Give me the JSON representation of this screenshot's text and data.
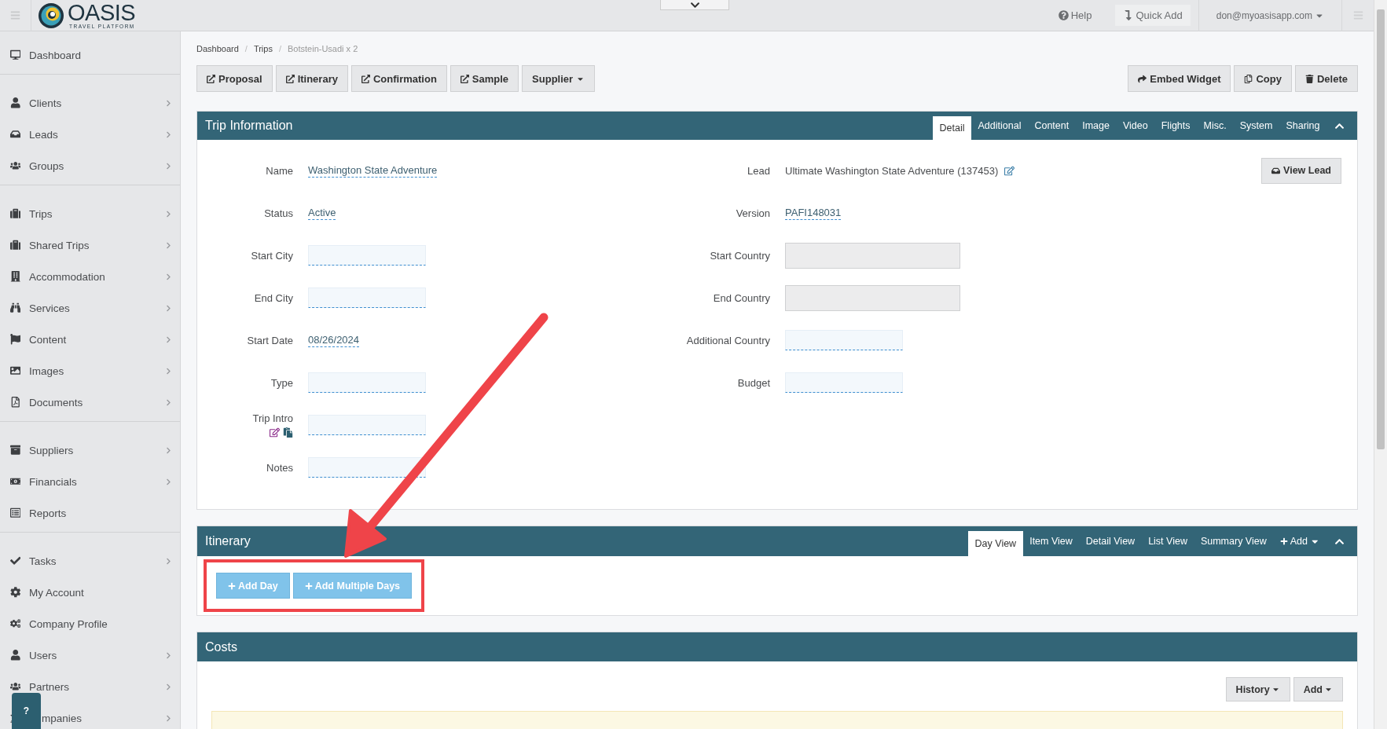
{
  "top_bar": {
    "logo": {
      "name": "OASIS",
      "tagline": "TRAVEL PLATFORM"
    },
    "links": [
      {
        "label": "Help"
      },
      {
        "label": "Quick Add"
      }
    ],
    "user": "don@myoasisapp.com"
  },
  "sidebar": {
    "groups": [
      [
        {
          "label": "Dashboard",
          "has_submenu": false,
          "covered": false
        }
      ],
      [
        {
          "label": "Clients",
          "has_submenu": true,
          "covered": false
        },
        {
          "label": "Leads",
          "has_submenu": true,
          "covered": false
        },
        {
          "label": "Groups",
          "has_submenu": true,
          "covered": false
        }
      ],
      [
        {
          "label": "Trips",
          "has_submenu": true,
          "covered": false
        },
        {
          "label": "Shared Trips",
          "has_submenu": true,
          "covered": false
        },
        {
          "label": "Accommodation",
          "has_submenu": true,
          "covered": false
        },
        {
          "label": "Services",
          "has_submenu": true,
          "covered": false
        },
        {
          "label": "Content",
          "has_submenu": true,
          "covered": false
        },
        {
          "label": "Images",
          "has_submenu": true,
          "covered": false
        },
        {
          "label": "Documents",
          "has_submenu": true,
          "covered": false
        }
      ],
      [
        {
          "label": "Suppliers",
          "has_submenu": true,
          "covered": false
        },
        {
          "label": "Financials",
          "has_submenu": true,
          "covered": false
        },
        {
          "label": "Reports",
          "has_submenu": false,
          "covered": false
        }
      ],
      [
        {
          "label": "Tasks",
          "has_submenu": true,
          "covered": false
        },
        {
          "label": "My Account",
          "has_submenu": false,
          "covered": false
        },
        {
          "label": "Company Profile",
          "has_submenu": false,
          "covered": false
        },
        {
          "label": "Users",
          "has_submenu": true,
          "covered": false
        },
        {
          "label": "Partners",
          "has_submenu": true,
          "covered": false
        },
        {
          "label": "mpanies",
          "has_submenu": true,
          "covered": true
        }
      ]
    ]
  },
  "help_button": "?",
  "breadcrumb": [
    {
      "label": "Dashboard",
      "current": false,
      "separator": "/"
    },
    {
      "label": "Trips",
      "current": false,
      "separator": "/"
    },
    {
      "label": "Botstein-Usadi x 2",
      "current": true
    }
  ],
  "actions_left": [
    {
      "label": "Proposal",
      "kind": "link"
    },
    {
      "label": "Itinerary",
      "kind": "link"
    },
    {
      "label": "Confirmation",
      "kind": "link"
    },
    {
      "label": "Sample",
      "kind": "link"
    },
    {
      "label": "Supplier",
      "kind": "dropdown"
    }
  ],
  "actions_right": [
    {
      "label": "Embed Widget"
    },
    {
      "label": "Copy"
    },
    {
      "label": "Delete"
    }
  ],
  "trip_information": {
    "title": "Trip Information",
    "tabs": [
      {
        "label": "Detail",
        "selected": true
      },
      {
        "label": "Additional",
        "selected": false
      },
      {
        "label": "Content",
        "selected": false
      },
      {
        "label": "Image",
        "selected": false
      },
      {
        "label": "Video",
        "selected": false
      },
      {
        "label": "Flights",
        "selected": false
      },
      {
        "label": "Misc.",
        "selected": false
      },
      {
        "label": "System",
        "selected": false
      },
      {
        "label": "Sharing",
        "selected": false
      }
    ],
    "view_lead": "View Lead",
    "rows": [
      {
        "left": {
          "label": "Name",
          "kind": "value",
          "value": "Washington State Adventure"
        },
        "right": {
          "label": "Lead",
          "kind": "text",
          "value": "Ultimate Washington State Adventure (137453)"
        }
      },
      {
        "left": {
          "label": "Status",
          "kind": "value",
          "value": "Active"
        },
        "right": {
          "label": "Version",
          "kind": "value",
          "value": "PAFI148031"
        }
      },
      {
        "left": {
          "label": "Start City",
          "kind": "input"
        },
        "right": {
          "label": "Start Country",
          "kind": "disabled"
        }
      },
      {
        "left": {
          "label": "End City",
          "kind": "input"
        },
        "right": {
          "label": "End Country",
          "kind": "disabled"
        }
      },
      {
        "left": {
          "label": "Start Date",
          "kind": "value",
          "value": "08/26/2024"
        },
        "right": {
          "label": "Additional Country",
          "kind": "input"
        }
      },
      {
        "left": {
          "label": "Type",
          "kind": "input"
        },
        "right": {
          "label": "Budget",
          "kind": "input"
        }
      },
      {
        "left": {
          "label": "Trip Intro",
          "kind": "intro"
        }
      },
      {
        "left": {
          "label": "Notes",
          "kind": "input"
        }
      }
    ]
  },
  "itinerary": {
    "title": "Itinerary",
    "tabs": [
      {
        "label": "Day View",
        "selected": true
      },
      {
        "label": "Item View",
        "selected": false
      },
      {
        "label": "Detail View",
        "selected": false
      },
      {
        "label": "List View",
        "selected": false
      },
      {
        "label": "Summary View",
        "selected": false
      }
    ],
    "add_menu": "Add",
    "buttons": [
      {
        "label": "Add Day"
      },
      {
        "label": "Add Multiple Days"
      }
    ]
  },
  "costs": {
    "title": "Costs",
    "buttons": [
      {
        "label": "History"
      },
      {
        "label": "Add"
      }
    ]
  }
}
